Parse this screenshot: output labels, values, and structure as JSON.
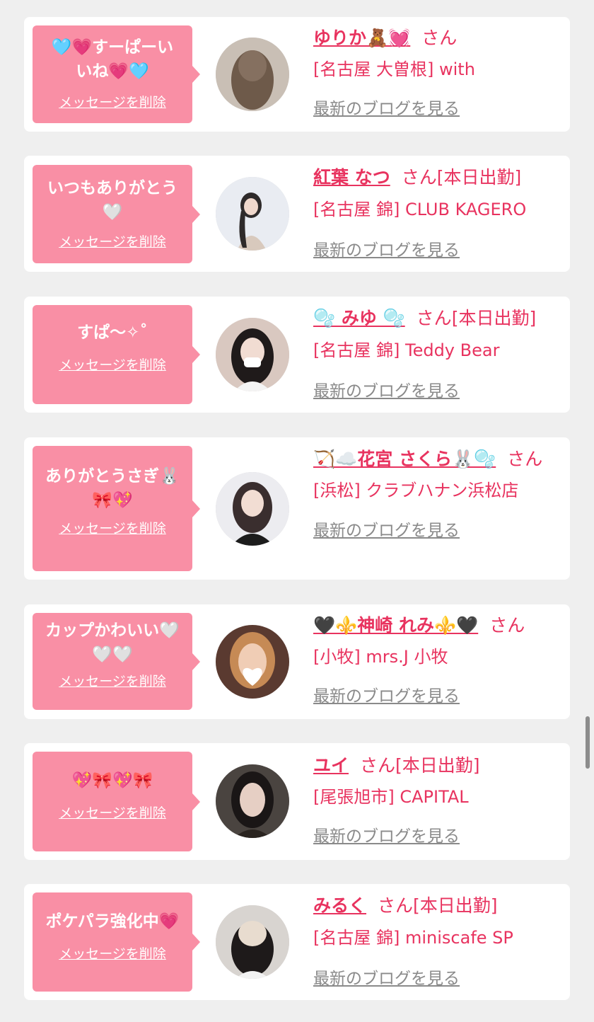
{
  "items": [
    {
      "message": "🩵💗すーぱーい\nいね💗🩵",
      "delete_label": "メッセージを削除",
      "name": "ゆりか🧸💓",
      "suffix": "さん",
      "status": "",
      "shop": "[名古屋 大曽根] with",
      "blog_label": "最新のブログを見る",
      "avatar_icon": "cast-photo-icon"
    },
    {
      "message": "いつもありがとう\n🤍",
      "delete_label": "メッセージを削除",
      "name": "紅葉 なつ",
      "suffix": "さん",
      "status": "[本日出勤]",
      "shop": "[名古屋 錦] CLUB KAGERO",
      "blog_label": "最新のブログを見る",
      "avatar_icon": "cast-photo-icon"
    },
    {
      "message": "すぱ〜✧˚",
      "delete_label": "メッセージを削除",
      "name": "🫧 みゆ 🫧",
      "suffix": "さん",
      "status": "[本日出勤]",
      "shop": "[名古屋 錦] Teddy Bear",
      "blog_label": "最新のブログを見る",
      "avatar_icon": "cast-photo-icon"
    },
    {
      "message": "ありがとうさぎ🐰\n🎀💖",
      "delete_label": "メッセージを削除",
      "name": "🏹☁️花宮 さくら🐰🫧",
      "suffix": "さん",
      "status": "",
      "shop": "[浜松] クラブハナン浜松店",
      "blog_label": "最新のブログを見る",
      "avatar_icon": "cast-photo-icon"
    },
    {
      "message": "カップかわいい🤍\n🤍🤍",
      "delete_label": "メッセージを削除",
      "name": "🖤⚜️神崎 れみ⚜️🖤",
      "suffix": "さん",
      "status": "",
      "shop": "[小牧] mrs.J 小牧",
      "blog_label": "最新のブログを見る",
      "avatar_icon": "cast-photo-icon"
    },
    {
      "message": "💖🎀💖🎀",
      "delete_label": "メッセージを削除",
      "name": "ユイ",
      "suffix": "さん",
      "status": "[本日出勤]",
      "shop": "[尾張旭市] CAPITAL",
      "blog_label": "最新のブログを見る",
      "avatar_icon": "cast-photo-icon"
    },
    {
      "message": "ポケパラ強化中💗",
      "delete_label": "メッセージを削除",
      "name": "みるく",
      "suffix": "さん",
      "status": "[本日出勤]",
      "shop": "[名古屋 錦] miniscafe SP",
      "blog_label": "最新のブログを見る",
      "avatar_icon": "cast-photo-icon"
    }
  ],
  "colors": {
    "accent": "#e8335f",
    "bubble": "#f98fa5",
    "card": "#ffffff",
    "background": "#efefef",
    "link_gray": "#8a8a8a"
  }
}
